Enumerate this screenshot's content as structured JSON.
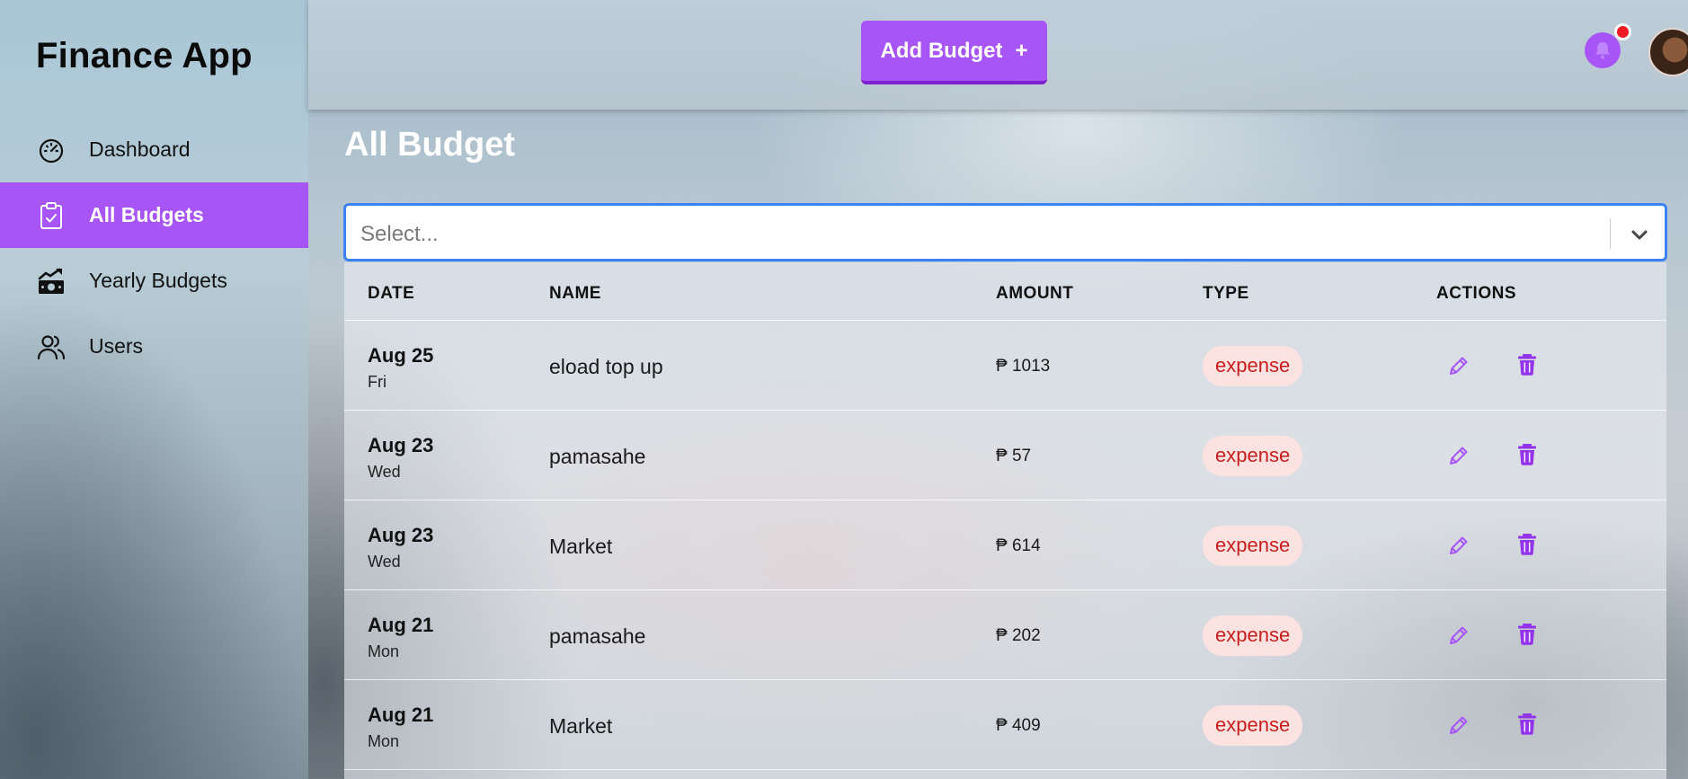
{
  "sidebar": {
    "brand": "Finance App",
    "items": [
      {
        "label": "Dashboard",
        "icon": "gauge-icon",
        "active": false
      },
      {
        "label": "All Budgets",
        "icon": "clipboard-check-icon",
        "active": true
      },
      {
        "label": "Yearly Budgets",
        "icon": "money-chart-icon",
        "active": false
      },
      {
        "label": "Users",
        "icon": "users-icon",
        "active": false
      }
    ]
  },
  "topbar": {
    "add_button_label": "Add Budget",
    "add_button_icon": "+",
    "bell_icon": "bell-icon",
    "avatar_icon": "avatar"
  },
  "main": {
    "title": "All Budget",
    "select_placeholder": "Select..."
  },
  "table": {
    "headers": {
      "date": "DATE",
      "name": "NAME",
      "amount": "AMOUNT",
      "type": "TYPE",
      "actions": "ACTIONS"
    },
    "rows": [
      {
        "date": "Aug 25",
        "day": "Fri",
        "name": "eload top up",
        "amount": "₱ 1013",
        "type": "expense"
      },
      {
        "date": "Aug 23",
        "day": "Wed",
        "name": "pamasahe",
        "amount": "₱ 57",
        "type": "expense"
      },
      {
        "date": "Aug 23",
        "day": "Wed",
        "name": "Market",
        "amount": "₱ 614",
        "type": "expense"
      },
      {
        "date": "Aug 21",
        "day": "Mon",
        "name": "pamasahe",
        "amount": "₱ 202",
        "type": "expense"
      },
      {
        "date": "Aug 21",
        "day": "Mon",
        "name": "Market",
        "amount": "₱ 409",
        "type": "expense"
      }
    ]
  },
  "colors": {
    "accent": "#a855f7",
    "accent_dark": "#7e22ce",
    "badge_bg": "#fde2e2",
    "badge_text": "#c81e1e",
    "notification_dot": "#ef1c24",
    "focus_border": "#3b82f6"
  }
}
